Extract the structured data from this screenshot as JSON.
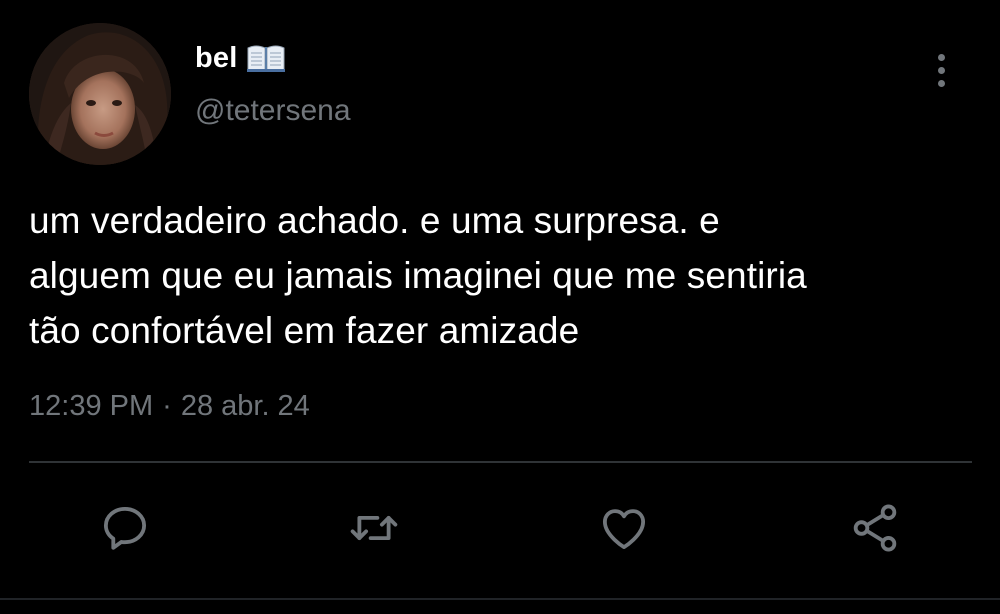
{
  "author": {
    "display_name": "bel",
    "name_emoji": "open-book-icon",
    "handle": "@tetersena",
    "avatar": "profile-photo"
  },
  "tweet": {
    "text": "um verdadeiro achado. e uma surpresa. e\nalguem que eu jamais imaginei que me sentiria\ntão confortável em fazer amizade",
    "time": "12:39 PM",
    "separator": "·",
    "date": "28 abr. 24"
  },
  "actions": {
    "reply": "reply-icon",
    "retweet": "retweet-icon",
    "like": "heart-icon",
    "share": "share-icon",
    "more": "more-vertical-icon"
  },
  "colors": {
    "background": "#000000",
    "text": "#ffffff",
    "secondary": "#71767b",
    "divider": "#2f3336"
  }
}
